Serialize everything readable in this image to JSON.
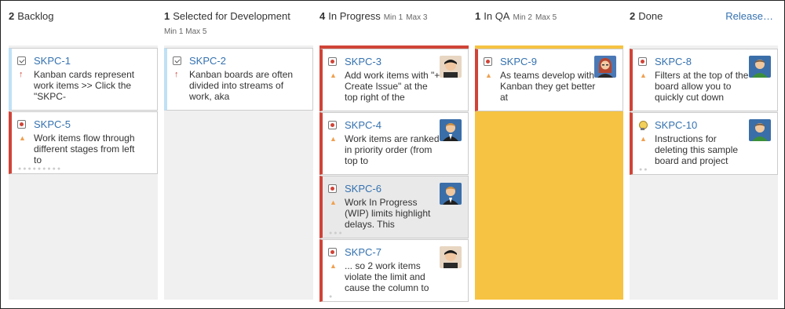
{
  "board": {
    "release_label": "Release…",
    "columns": [
      {
        "count": "2",
        "name": "Backlog",
        "min": "",
        "max": ""
      },
      {
        "count": "1",
        "name": "Selected for Development",
        "min": "Min 1",
        "max": "Max 5"
      },
      {
        "count": "4",
        "name": "In Progress",
        "min": "Min 1",
        "max": "Max 3"
      },
      {
        "count": "1",
        "name": "In QA",
        "min": "Min 2",
        "max": "Max 5"
      },
      {
        "count": "2",
        "name": "Done",
        "min": "",
        "max": ""
      }
    ]
  },
  "cards": {
    "skpc1": {
      "key": "SKPC-1",
      "summary": "Kanban cards represent work items >> Click the \"SKPC-",
      "type": "task-icon",
      "priority": "high"
    },
    "skpc5": {
      "key": "SKPC-5",
      "summary": "Work items flow through different stages from left to",
      "type": "bug-icon",
      "priority": "medium"
    },
    "skpc2": {
      "key": "SKPC-2",
      "summary": "Kanban boards are often divided into streams of work, aka",
      "type": "task-icon",
      "priority": "high"
    },
    "skpc3": {
      "key": "SKPC-3",
      "summary": "Add work items with \"+ Create Issue\" at the top right of the",
      "type": "bug-icon",
      "priority": "medium"
    },
    "skpc4": {
      "key": "SKPC-4",
      "summary": "Work items are ranked in priority order (from top to",
      "type": "bug-icon",
      "priority": "medium"
    },
    "skpc6": {
      "key": "SKPC-6",
      "summary": "Work In Progress (WIP) limits highlight delays. This",
      "type": "bug-icon",
      "priority": "medium"
    },
    "skpc7": {
      "key": "SKPC-7",
      "summary": "... so 2 work items violate the limit and cause the column to",
      "type": "bug-icon",
      "priority": "medium"
    },
    "skpc9": {
      "key": "SKPC-9",
      "summary": "As teams develop with Kanban they get better at",
      "type": "bug-icon",
      "priority": "medium"
    },
    "skpc8": {
      "key": "SKPC-8",
      "summary": "Filters at the top of the board allow you to quickly cut down",
      "type": "bug-icon",
      "priority": "medium"
    },
    "skpc10": {
      "key": "SKPC-10",
      "summary": "Instructions for deleting this sample board and project",
      "type": "lightbulb-icon",
      "priority": "medium"
    }
  },
  "colors": {
    "link": "#3572b0",
    "qa_background": "#f6c342",
    "in_progress_topbar": "#d04437",
    "card_red_stripe": "#d04437",
    "card_blue_stripe": "#bfe1f6"
  }
}
